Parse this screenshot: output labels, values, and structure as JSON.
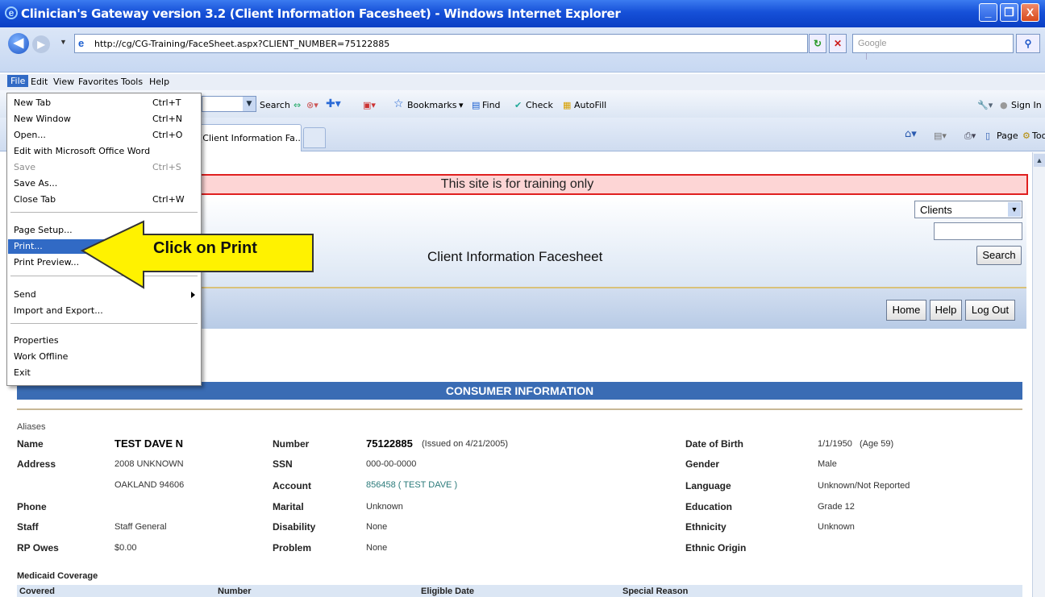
{
  "window": {
    "title": "Clinician's Gateway version 3.2 (Client Information Facesheet) - Windows Internet Explorer",
    "minimize": "_",
    "maximize": "❐",
    "close": "X"
  },
  "address_bar": {
    "url": "http://cg/CG-Training/FaceSheet.aspx?CLIENT_NUMBER=75122885",
    "search_placeholder": "Google"
  },
  "menu_bar": {
    "items": [
      "File",
      "Edit",
      "View",
      "Favorites",
      "Tools",
      "Help"
    ]
  },
  "toolbar": {
    "search": "Search",
    "bookmarks": "Bookmarks",
    "find": "Find",
    "check": "Check",
    "autofill": "AutoFill",
    "sign_in": "Sign In"
  },
  "tab": {
    "label": "(Client Information Fa..."
  },
  "command_bar": {
    "page": "Page",
    "tools": "Tools"
  },
  "file_menu": {
    "items": [
      {
        "label": "New Tab",
        "shortcut": "Ctrl+T"
      },
      {
        "label": "New Window",
        "shortcut": "Ctrl+N"
      },
      {
        "label": "Open...",
        "shortcut": "Ctrl+O"
      },
      {
        "label": "Edit with Microsoft Office Word",
        "shortcut": ""
      },
      {
        "label": "Save",
        "shortcut": "Ctrl+S"
      },
      {
        "label": "Save As...",
        "shortcut": ""
      },
      {
        "label": "Close Tab",
        "shortcut": "Ctrl+W"
      },
      {
        "label": "Page Setup...",
        "shortcut": ""
      },
      {
        "label": "Print...",
        "shortcut": ""
      },
      {
        "label": "Print Preview...",
        "shortcut": ""
      },
      {
        "label": "Send",
        "shortcut": ""
      },
      {
        "label": "Import and Export...",
        "shortcut": ""
      },
      {
        "label": "Properties",
        "shortcut": ""
      },
      {
        "label": "Work Offline",
        "shortcut": ""
      },
      {
        "label": "Exit",
        "shortcut": ""
      }
    ]
  },
  "callout": {
    "text": "Click on Print",
    "color": "#fff200"
  },
  "page": {
    "training_banner": "This site is for training only",
    "title": "Client Information Facesheet",
    "clients_select": "Clients",
    "search_button": "Search",
    "nav": {
      "home": "Home",
      "help": "Help",
      "logout": "Log Out"
    }
  },
  "consumer": {
    "header": "CONSUMER INFORMATION",
    "aliases_label": "Aliases",
    "name_label": "Name",
    "name": "TEST DAVE N",
    "address_label": "Address",
    "address1": "2008 UNKNOWN",
    "address2": "OAKLAND 94606",
    "phone_label": "Phone",
    "staff_label": "Staff",
    "staff": "Staff General",
    "rp_owes_label": "RP Owes",
    "rp_owes": "$0.00",
    "number_label": "Number",
    "number": "75122885",
    "number_issued": "(Issued on 4/21/2005)",
    "ssn_label": "SSN",
    "ssn": "000-00-0000",
    "account_label": "Account",
    "account": "856458 ( TEST DAVE )",
    "marital_label": "Marital",
    "marital": "Unknown",
    "disability_label": "Disability",
    "disability": "None",
    "problem_label": "Problem",
    "problem": "None",
    "dob_label": "Date of Birth",
    "dob": "1/1/1950   (Age 59)",
    "gender_label": "Gender",
    "gender": "Male",
    "language_label": "Language",
    "language": "Unknown/Not Reported",
    "education_label": "Education",
    "education": "Grade 12",
    "ethnicity_label": "Ethnicity",
    "ethnicity": "Unknown",
    "ethnic_origin_label": "Ethnic Origin",
    "medicaid_label": "Medicaid Coverage",
    "medicaid_columns": [
      "Covered",
      "Number",
      "Eligible Date",
      "Special Reason"
    ]
  }
}
